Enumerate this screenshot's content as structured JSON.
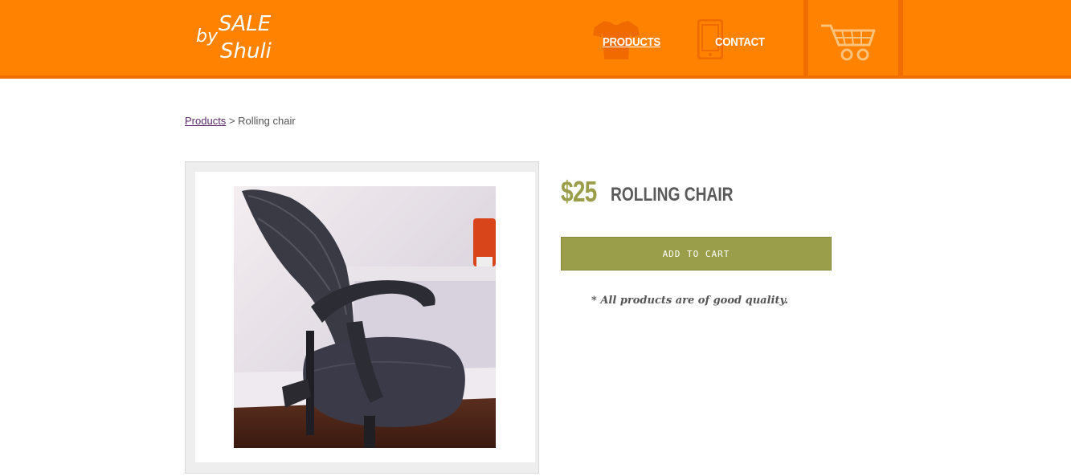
{
  "header": {
    "logo_text_line1": "SALE",
    "logo_text_by": "by",
    "logo_text_line2": "Shuli",
    "nav": [
      {
        "label": "PRODUCTS",
        "icon": "tshirt-icon"
      },
      {
        "label": "CONTACT",
        "icon": "phone-icon"
      }
    ],
    "cart_icon": "shopping-cart-icon"
  },
  "breadcrumb": {
    "link": "Products",
    "separator": ">",
    "current": "Rolling chair"
  },
  "product": {
    "price": "$25",
    "name": "ROLLING CHAIR",
    "add_to_cart_label": "ADD TO CART",
    "note": "* All products are of good quality."
  },
  "colors": {
    "header": "#ff8200",
    "accent": "#9a9e4a"
  }
}
